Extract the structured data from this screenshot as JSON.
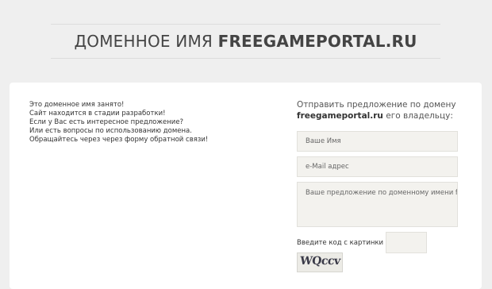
{
  "header": {
    "title_prefix": "ДОМЕННОЕ ИМЯ",
    "title_domain": "FREEGAMEPORTAL.RU"
  },
  "intro": {
    "lines": [
      "Это доменное имя занято!",
      "Сайт находится в стадии разработки!",
      "Если у Вас есть интересное предложение?",
      "Или есть вопросы по использованию домена.",
      "Обращайтесь через через форму обратной связи!"
    ]
  },
  "offer_form": {
    "heading_line1": "Отправить предложение по домену",
    "heading_domain": "freegameportal.ru",
    "heading_suffix": "его владельцу:",
    "name_placeholder": "Ваше Имя",
    "email_placeholder": "e-Mail адрес",
    "message_placeholder": "Ваше предложение по доменному имени freegameportal.ru",
    "captcha_label": "Введите код с картинки",
    "captcha_text": "WQccv"
  },
  "colors": {
    "page_background": "#efefef",
    "card_background": "#ffffff",
    "field_background": "#f3f2ee"
  }
}
